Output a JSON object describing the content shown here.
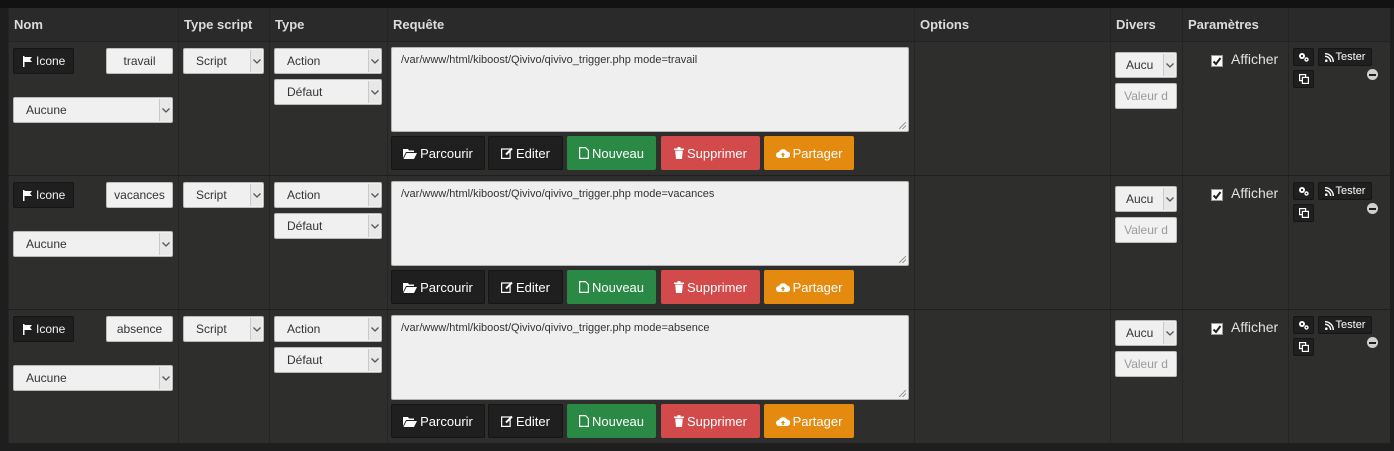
{
  "headers": [
    "Nom",
    "Type script",
    "Type",
    "Requête",
    "Options",
    "Divers",
    "Paramètres",
    ""
  ],
  "common": {
    "icon_button": "Icone",
    "icon_select": "Aucune",
    "type_script": "Script",
    "type": "Action",
    "subtype": "Défaut",
    "divers_select": "Aucu",
    "divers_placeholder": "Valeur d",
    "afficher": "Afficher",
    "afficher_checked": true,
    "tester": "Tester",
    "actions": {
      "parcourir": "Parcourir",
      "editer": "Editer",
      "nouveau": "Nouveau",
      "supprimer": "Supprimer",
      "partager": "Partager"
    }
  },
  "colors": {
    "nouveau": "#2a8a45",
    "supprimer": "#d24a4a",
    "partager": "#e48a0f"
  },
  "rows": [
    {
      "name": "travail",
      "request": "/var/www/html/kiboost/Qivivo/qivivo_trigger.php mode=travail"
    },
    {
      "name": "vacances",
      "request": "/var/www/html/kiboost/Qivivo/qivivo_trigger.php mode=vacances"
    },
    {
      "name": "absence",
      "request": "/var/www/html/kiboost/Qivivo/qivivo_trigger.php mode=absence"
    }
  ]
}
